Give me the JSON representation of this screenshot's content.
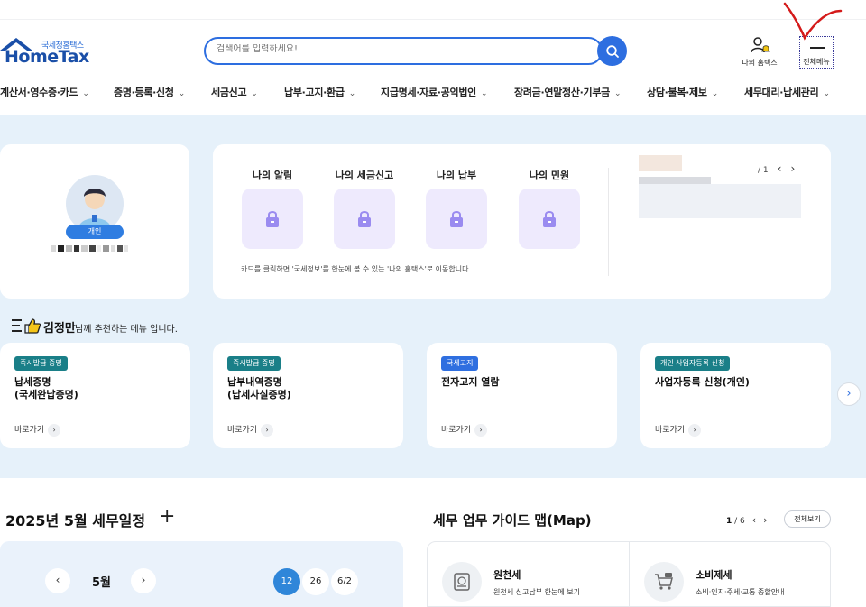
{
  "header": {
    "logo_sub": "국세청홈택스",
    "logo_main": "HomeTax",
    "search_placeholder": "검색어를 입력하세요!",
    "my_hometax_label": "나의 홈택스",
    "all_menu_label": "전체메뉴"
  },
  "nav": {
    "items": [
      {
        "label": "계산서·영수증·카드"
      },
      {
        "label": "증명·등록·신청"
      },
      {
        "label": "세금신고"
      },
      {
        "label": "납부·고지·환급"
      },
      {
        "label": "지급명세·자료·공익법인"
      },
      {
        "label": "장려금·연말정산·기부금"
      },
      {
        "label": "상담·불복·제보"
      },
      {
        "label": "세무대리·납세관리"
      }
    ]
  },
  "profile": {
    "badge": "개인"
  },
  "mine": {
    "items": [
      {
        "title": "나의 알림"
      },
      {
        "title": "나의 세금신고"
      },
      {
        "title": "나의 납부"
      },
      {
        "title": "나의 민원"
      }
    ],
    "description": "카드를 클릭하면 '국세정보'를 한눈에 볼 수 있는 '나의 홈택스'로 이동합니다.",
    "pager": "/ 1"
  },
  "recommend": {
    "name": "김정만",
    "suffix": "님께 추천하는 메뉴 입니다.",
    "cards": [
      {
        "tag": "즉시발급 증명",
        "tag_color": "#1a7f88",
        "name": "납세증명\n(국세완납증명)",
        "go": "바로가기"
      },
      {
        "tag": "즉시발급 증명",
        "tag_color": "#1a7f88",
        "name": "납부내역증명\n(납세사실증명)",
        "go": "바로가기"
      },
      {
        "tag": "국세고지",
        "tag_color": "#2f6fe0",
        "name": "전자고지 열람",
        "go": "바로가기"
      },
      {
        "tag": "개인 사업자등록 신청",
        "tag_color": "#1a7f88",
        "name": "사업자등록 신청(개인)",
        "go": "바로가기"
      }
    ]
  },
  "schedule": {
    "title": "2025년 5월 세무일정",
    "month": "5월",
    "days": [
      "12",
      "26",
      "6/2"
    ],
    "active_day": "12"
  },
  "guide": {
    "title": "세무 업무 가이드 맵(Map)",
    "page_current": "1",
    "page_total": "/ 6",
    "view_all": "전체보기",
    "items": [
      {
        "name": "원천세",
        "desc": "원천세 신고납부 한눈에 보기"
      },
      {
        "name": "소비제세",
        "desc": "소비·인지·주세·교통 종합안내"
      }
    ]
  },
  "colors": {
    "brand_blue": "#2d6ee0",
    "band_bg": "#e6f1fa",
    "teal_tag": "#1a7f88"
  }
}
